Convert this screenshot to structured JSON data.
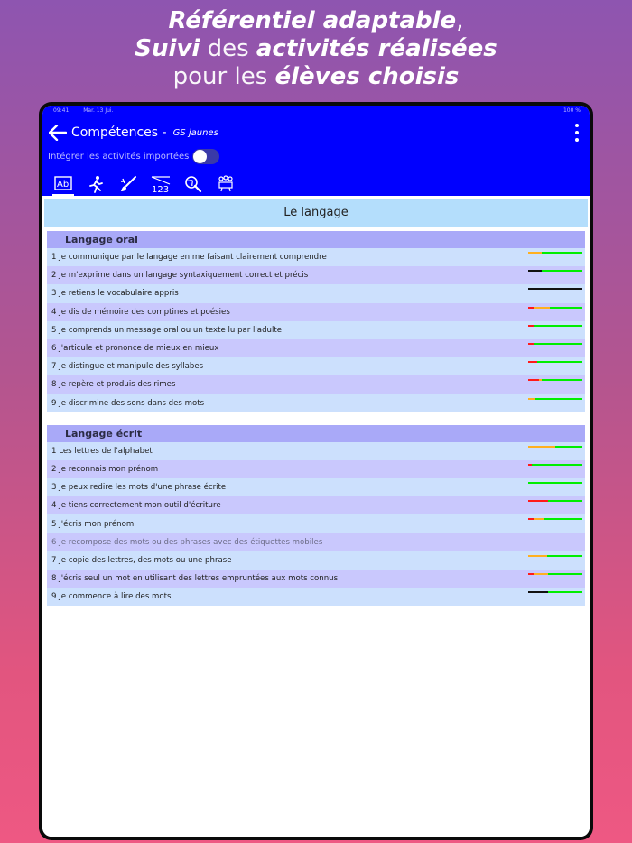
{
  "promo": {
    "l1a": "Référentiel adaptable",
    "l1b": ",",
    "l2a": "Suivi",
    "l2b": " des ",
    "l2c": "activités réalisées",
    "l3a": "pour les ",
    "l3b": "élèves choisis"
  },
  "status": {
    "time": "09:41",
    "date": "Mar. 13 Jui.",
    "battery": "100 %"
  },
  "appbar": {
    "title": "Compétences -",
    "subtitle": "GS jaunes",
    "toggle_label": "Intégrer les activités importées",
    "toggle_on": false,
    "tabs": [
      "lecture-ab-icon",
      "running-person-icon",
      "paintbrush-icon",
      "numbers-123-icon",
      "world-search-icon",
      "group-board-icon"
    ]
  },
  "section": {
    "title": "Le langage"
  },
  "colors": {
    "appbar": "#0000ff",
    "red": "#ff1a1a",
    "orange": "#ffb020",
    "green": "#00ee00",
    "black": "#111111"
  },
  "groups": [
    {
      "title": "Langage oral",
      "items": [
        {
          "text": "1 Je communique par le langage en me faisant clairement comprendre",
          "progress": [
            [
              "orange",
              0.25
            ],
            [
              "green",
              0.75
            ]
          ]
        },
        {
          "text": "2 Je m'exprime dans un langage syntaxiquement correct et précis",
          "progress": [
            [
              "black",
              0.25
            ],
            [
              "green",
              0.75
            ]
          ]
        },
        {
          "text": "3 Je retiens le vocabulaire appris",
          "progress": [
            [
              "black",
              1.0
            ]
          ]
        },
        {
          "text": "4 Je dis de mémoire des comptines et poésies",
          "progress": [
            [
              "red",
              0.12
            ],
            [
              "orange",
              0.28
            ],
            [
              "green",
              0.6
            ]
          ]
        },
        {
          "text": "5 Je comprends un message oral ou un texte lu par l'adulte",
          "progress": [
            [
              "red",
              0.12
            ],
            [
              "green",
              0.88
            ]
          ]
        },
        {
          "text": "6 J'articule et prononce de mieux en mieux",
          "progress": [
            [
              "red",
              0.12
            ],
            [
              "green",
              0.88
            ]
          ]
        },
        {
          "text": "7 Je distingue et manipule des syllabes",
          "progress": [
            [
              "red",
              0.17
            ],
            [
              "green",
              0.83
            ]
          ]
        },
        {
          "text": "8 Je repère et produis des rimes",
          "progress": [
            [
              "red",
              0.2
            ],
            [
              "orange",
              0.05
            ],
            [
              "green",
              0.75
            ]
          ]
        },
        {
          "text": "9 Je discrimine des sons dans des mots",
          "progress": [
            [
              "orange",
              0.13
            ],
            [
              "green",
              0.87
            ]
          ]
        }
      ]
    },
    {
      "title": "Langage écrit",
      "items": [
        {
          "text": "1 Les lettres de l'alphabet",
          "progress": [
            [
              "orange",
              0.5
            ],
            [
              "green",
              0.5
            ]
          ]
        },
        {
          "text": "2 Je reconnais mon prénom",
          "progress": [
            [
              "red",
              0.07
            ],
            [
              "green",
              0.93
            ]
          ]
        },
        {
          "text": "3 Je peux redire les mots d'une phrase écrite",
          "progress": [
            [
              "green",
              1.0
            ]
          ]
        },
        {
          "text": "4 Je tiens correctement mon outil d'écriture",
          "progress": [
            [
              "red",
              0.37
            ],
            [
              "green",
              0.63
            ]
          ]
        },
        {
          "text": "5 J'écris mon prénom",
          "progress": [
            [
              "red",
              0.12
            ],
            [
              "orange",
              0.18
            ],
            [
              "green",
              0.7
            ]
          ]
        },
        {
          "text": "6 Je recompose des mots ou des phrases avec des étiquettes mobiles",
          "progress": [],
          "dim": true
        },
        {
          "text": "7 Je copie des lettres, des mots ou une phrase",
          "progress": [
            [
              "orange",
              0.35
            ],
            [
              "green",
              0.65
            ]
          ]
        },
        {
          "text": "8 J'écris seul un mot en utilisant des lettres empruntées aux mots connus",
          "progress": [
            [
              "red",
              0.12
            ],
            [
              "orange",
              0.25
            ],
            [
              "green",
              0.63
            ]
          ]
        },
        {
          "text": "9 Je commence à lire des mots",
          "progress": [
            [
              "black",
              0.37
            ],
            [
              "green",
              0.63
            ]
          ]
        }
      ]
    }
  ]
}
